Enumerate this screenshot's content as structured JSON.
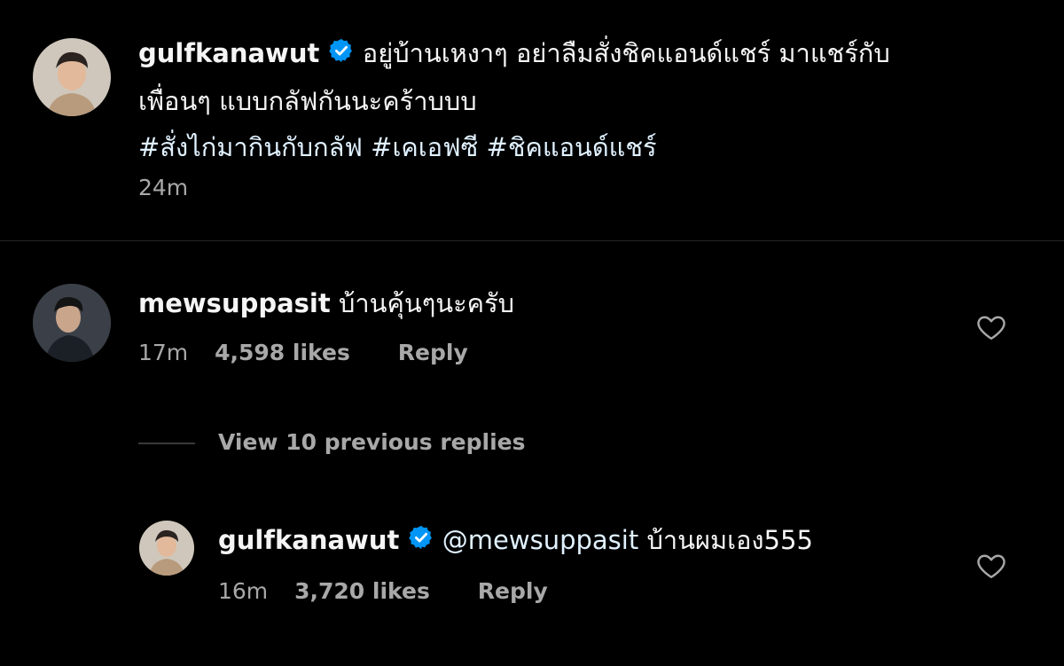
{
  "caption": {
    "username": "gulfkanawut",
    "text_line1": "อยู่บ้านเหงาๆ อย่าลืมสั่งชิคแอนด์แชร์ มาแชร์กับ",
    "text_line2": "เพื่อนๆ แบบกลัฟกันนะคร้าบบบ",
    "hashtags": [
      "#สั่งไก่มากินกับกลัฟ",
      "#เคเอฟซี",
      "#ชิคแอนด์แชร์"
    ],
    "time": "24m"
  },
  "comments": [
    {
      "username": "mewsuppasit",
      "text": "บ้านคุ้นๆนะครับ",
      "time": "17m",
      "likes": "4,598 likes",
      "reply_label": "Reply"
    }
  ],
  "view_replies": "View 10 previous replies",
  "reply": {
    "username": "gulfkanawut",
    "mention": "@mewsuppasit",
    "text": "บ้านผมเอง555",
    "time": "16m",
    "likes": "3,720 likes",
    "reply_label": "Reply"
  },
  "colors": {
    "background": "#000000",
    "text": "#f5f5f5",
    "secondary": "#a8a8a8",
    "verified": "#0095f6",
    "link": "#e0f1ff",
    "divider": "#262626"
  },
  "icons": {
    "verified": "verified-badge-icon",
    "like": "heart-outline-icon"
  }
}
